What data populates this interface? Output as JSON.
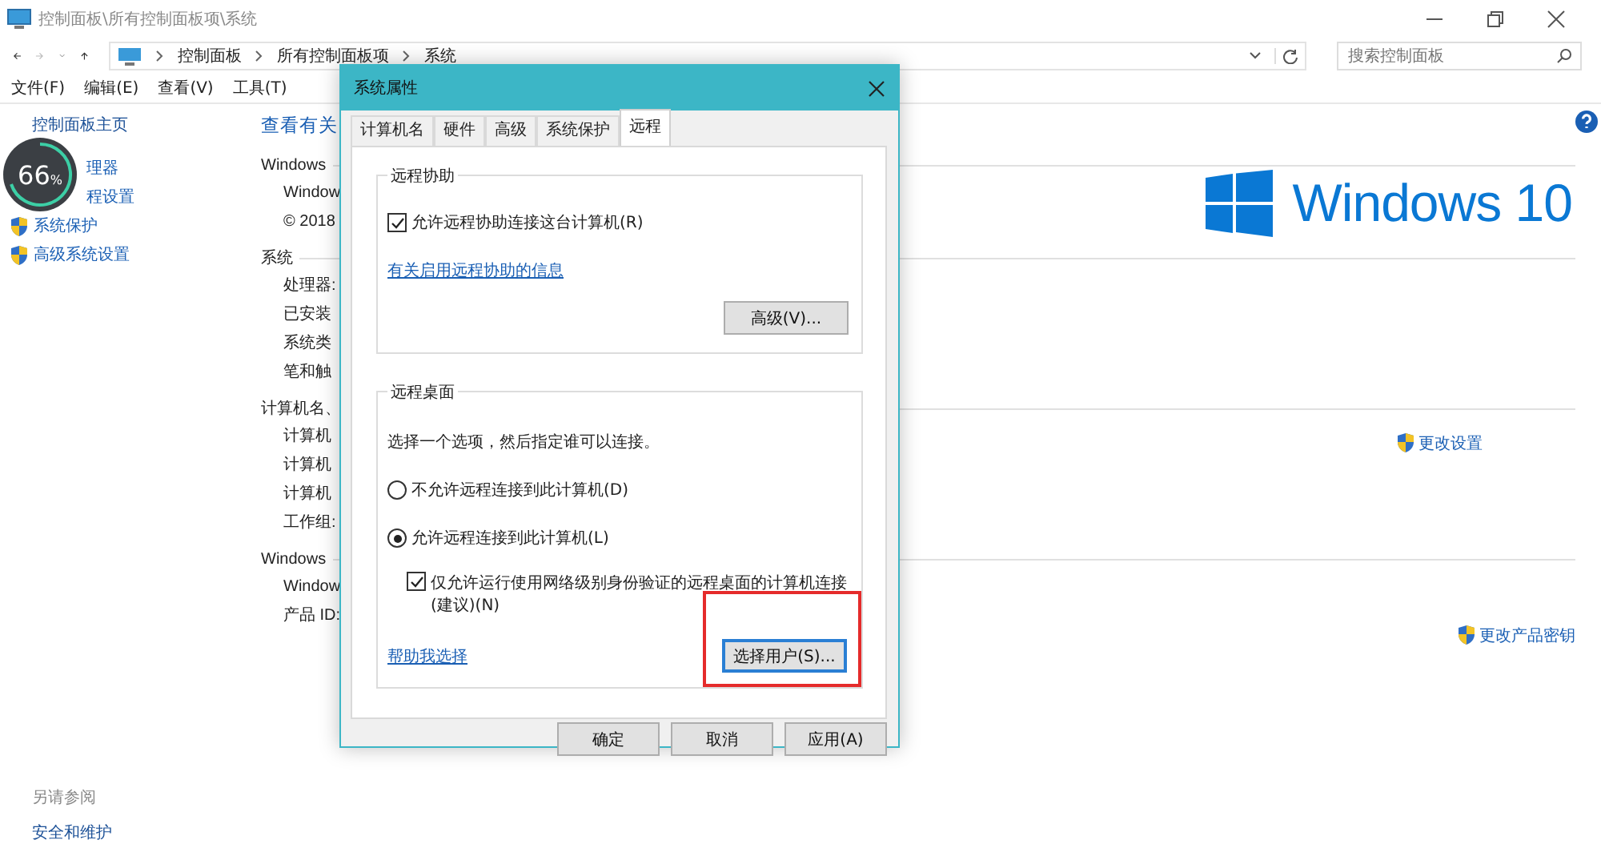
{
  "window": {
    "title": "控制面板\\所有控制面板项\\系统"
  },
  "nav": {
    "crumbs": [
      "控制面板",
      "所有控制面板项",
      "系统"
    ],
    "search_placeholder": "搜索控制面板"
  },
  "menu": [
    "文件(F)",
    "编辑(E)",
    "查看(V)",
    "工具(T)"
  ],
  "sidebar": {
    "home": "控制面板主页",
    "items": [
      {
        "label": "理器",
        "shield": false
      },
      {
        "label": "程设置",
        "shield": false
      },
      {
        "label": "系统保护",
        "shield": true
      },
      {
        "label": "高级系统设置",
        "shield": true
      }
    ]
  },
  "overlay_badge": {
    "value": "66",
    "unit": "%"
  },
  "main": {
    "heading": "查看有关",
    "sections": [
      {
        "title": "Windows",
        "rows": [
          "Window",
          "© 2018"
        ],
        "logo_text": "Windows 10"
      },
      {
        "title": "系统",
        "rows": [
          "处理器:",
          "已安装",
          "系统类",
          "笔和触"
        ]
      },
      {
        "title": "计算机名、",
        "rows": [
          "计算机",
          "计算机",
          "计算机",
          "工作组:"
        ],
        "side_link": "更改设置"
      },
      {
        "title": "Windows",
        "rows": [
          "Window",
          "产品 ID:"
        ],
        "side_link": "更改产品密钥"
      }
    ]
  },
  "see_also": {
    "title": "另请参阅",
    "links": [
      "安全和维护"
    ]
  },
  "dialog": {
    "title": "系统属性",
    "tabs": [
      {
        "label": "计算机名",
        "selected": false
      },
      {
        "label": "硬件",
        "selected": false
      },
      {
        "label": "高级",
        "selected": false
      },
      {
        "label": "系统保护",
        "selected": false
      },
      {
        "label": "远程",
        "selected": true
      }
    ],
    "remote_assistance": {
      "title": "远程协助",
      "allow": {
        "label": "允许远程协助连接这台计算机(R)",
        "checked": true
      },
      "info_link": "有关启用远程协助的信息",
      "advanced_button": "高级(V)..."
    },
    "remote_desktop": {
      "title": "远程桌面",
      "instruction": "选择一个选项，然后指定谁可以连接。",
      "options": [
        {
          "label": "不允许远程连接到此计算机(D)",
          "selected": false
        },
        {
          "label": "允许远程连接到此计算机(L)",
          "selected": true
        }
      ],
      "nla": {
        "label": "仅允许运行使用网络级别身份验证的远程桌面的计算机连接(建议)(N)",
        "checked": true
      },
      "help_link": "帮助我选择",
      "select_users_button": "选择用户(S)...",
      "highlighted": true
    },
    "buttons": [
      "确定",
      "取消",
      "应用(A)"
    ]
  }
}
